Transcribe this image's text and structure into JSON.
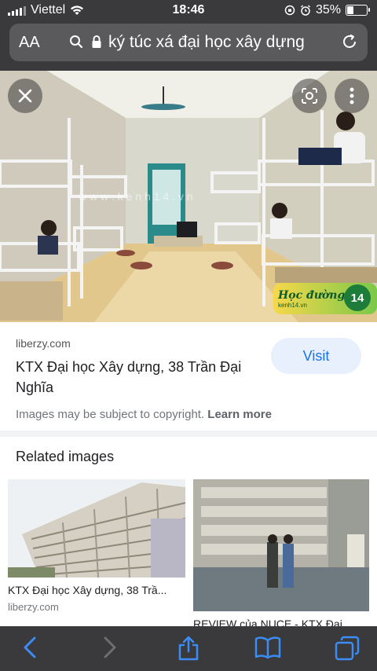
{
  "status": {
    "carrier": "Viettel",
    "time": "18:46",
    "battery": "35%",
    "battery_level": 0.35
  },
  "address_bar": {
    "aa_label": "AA",
    "query": "ký túc xá đại học xây dựng"
  },
  "hero": {
    "watermark": "w w w . k e n h 1 4 . v n",
    "badge_text": "Học đường",
    "badge_sub": "kenh14.vn",
    "badge_number": "14"
  },
  "result": {
    "source": "liberzy.com",
    "title": "KTX Đại học Xây dựng, 38 Trần Đại Nghĩa",
    "visit_label": "Visit",
    "copyright_text": "Images may be subject to copyright.",
    "learn_more": "Learn more"
  },
  "related": {
    "heading": "Related images",
    "items": [
      {
        "caption": "KTX Đại học Xây dựng, 38 Trầ...",
        "source": "liberzy.com"
      },
      {
        "caption": "REVIEW của NUCE - KTX Đại",
        "source": ""
      }
    ]
  },
  "toolbar": {
    "back": "back-icon",
    "forward": "forward-icon",
    "share": "share-icon",
    "bookmarks": "bookmarks-icon",
    "tabs": "tabs-icon"
  }
}
